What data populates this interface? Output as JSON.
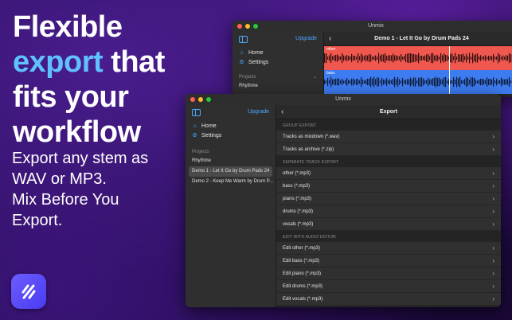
{
  "marketing": {
    "headline_line1": "Flexible",
    "headline_accent": "export",
    "headline_rest1": " that",
    "headline_line3": "fits your",
    "headline_line4": "workflow",
    "subtext_line1": "Export any stem as",
    "subtext_line2": "WAV or MP3.",
    "subtext_line3": "Mix Before You",
    "subtext_line4": "Export."
  },
  "back_window": {
    "title": "Unmix",
    "upgrade": "Upgrade",
    "nav": [
      {
        "label": "Home",
        "icon": "house-icon"
      },
      {
        "label": "Settings",
        "icon": "gear-icon"
      }
    ],
    "projects_label": "Projects",
    "projects": [
      "Rhythme"
    ],
    "header_title": "Demo 1 - Let It Go by Drum Pads 24",
    "tracks": [
      {
        "label": "other",
        "color": "#f0574f"
      },
      {
        "label": "bass",
        "color": "#3d7bf0"
      }
    ]
  },
  "front_window": {
    "title": "Unmix",
    "upgrade": "Upgrade",
    "nav": [
      {
        "label": "Home",
        "icon": "house-icon"
      },
      {
        "label": "Settings",
        "icon": "gear-icon"
      }
    ],
    "projects_label": "Projects",
    "projects": [
      {
        "label": "Rhythme",
        "selected": false
      },
      {
        "label": "Demo 1 - Let It Go by Drum Pads 24",
        "selected": true
      },
      {
        "label": "Demo 2 - Keep Me Warm by Drum P...",
        "selected": false
      }
    ],
    "header_title": "Export",
    "groups": [
      {
        "label": "GROUP EXPORT",
        "rows": [
          "Tracks as mixdown (*.wav)",
          "Tracks as archive (*.zip)"
        ]
      },
      {
        "label": "SEPARATE TRACK EXPORT",
        "rows": [
          "other (*.mp3)",
          "bass (*.mp3)",
          "piano (*.mp3)",
          "drums (*.mp3)",
          "vocals (*.mp3)"
        ]
      },
      {
        "label": "EDIT WITH AUDIO EDITOR",
        "rows": [
          "Edit other (*.mp3)",
          "Edit bass (*.mp3)",
          "Edit piano (*.mp3)",
          "Edit drums (*.mp3)",
          "Edit vocals (*.mp3)"
        ]
      }
    ]
  },
  "colors": {
    "accent": "#5fc1ff",
    "link": "#4aa8ff",
    "other_track": "#f0574f",
    "bass_track": "#3d7bf0"
  }
}
